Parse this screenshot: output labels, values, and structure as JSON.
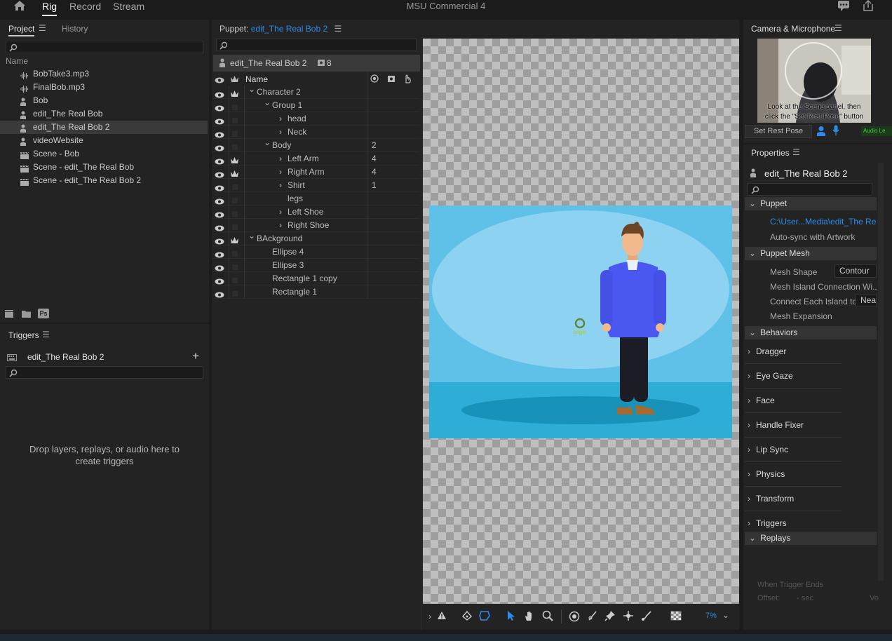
{
  "topbar": {
    "tabs": [
      "Rig",
      "Record",
      "Stream"
    ],
    "title": "MSU Commercial 4"
  },
  "project": {
    "tabs": [
      "Project",
      "History"
    ],
    "column_header": "Name",
    "items": [
      {
        "label": "BobTake3.mp3",
        "icon": "audio-icon"
      },
      {
        "label": "FinalBob.mp3",
        "icon": "audio-icon"
      },
      {
        "label": "Bob",
        "icon": "puppet-icon"
      },
      {
        "label": "edit_The Real Bob",
        "icon": "puppet-icon"
      },
      {
        "label": "edit_The Real Bob 2",
        "icon": "puppet-icon",
        "selected": true
      },
      {
        "label": "videoWebsite",
        "icon": "puppet-icon"
      },
      {
        "label": "Scene - Bob",
        "icon": "scene-icon"
      },
      {
        "label": "Scene - edit_The Real Bob",
        "icon": "scene-icon"
      },
      {
        "label": "Scene - edit_The Real Bob 2",
        "icon": "scene-icon"
      }
    ],
    "footer_ps": "Ps"
  },
  "triggers": {
    "title": "Triggers",
    "puppet": "edit_The Real Bob 2",
    "drop_text_1": "Drop layers, replays, or audio here to",
    "drop_text_2": "create triggers"
  },
  "puppet_panel": {
    "title_prefix": "Puppet:",
    "title_link": "edit_The Real Bob 2",
    "puppet_name": "edit_The Real Bob 2",
    "count": "8",
    "col_name": "Name",
    "layers": [
      {
        "label": "Character 2",
        "indent": 0,
        "chevron": "down",
        "crown": true,
        "count": ""
      },
      {
        "label": "Group 1",
        "indent": 1,
        "chevron": "down",
        "crown": false,
        "count": ""
      },
      {
        "label": "head",
        "indent": 2,
        "chevron": "right",
        "crown": false,
        "count": ""
      },
      {
        "label": "Neck",
        "indent": 2,
        "chevron": "right",
        "crown": false,
        "count": ""
      },
      {
        "label": "Body",
        "indent": 1,
        "chevron": "down",
        "crown": false,
        "count": "2"
      },
      {
        "label": "Left Arm",
        "indent": 2,
        "chevron": "right",
        "crown": true,
        "count": "4"
      },
      {
        "label": "Right Arm",
        "indent": 2,
        "chevron": "right",
        "crown": true,
        "count": "4"
      },
      {
        "label": "Shirt",
        "indent": 2,
        "chevron": "right",
        "crown": false,
        "count": "1"
      },
      {
        "label": "legs",
        "indent": 2,
        "chevron": "",
        "crown": false,
        "count": ""
      },
      {
        "label": "Left Shoe",
        "indent": 2,
        "chevron": "right",
        "crown": false,
        "count": ""
      },
      {
        "label": "Right Shoe",
        "indent": 2,
        "chevron": "right",
        "crown": false,
        "count": ""
      },
      {
        "label": "BAckground",
        "indent": 0,
        "chevron": "down",
        "crown": true,
        "count": ""
      },
      {
        "label": "Ellipse 4",
        "indent": 1,
        "chevron": "",
        "crown": false,
        "count": ""
      },
      {
        "label": "Ellipse 3",
        "indent": 1,
        "chevron": "",
        "crown": false,
        "count": ""
      },
      {
        "label": "Rectangle 1 copy",
        "indent": 1,
        "chevron": "",
        "crown": false,
        "count": ""
      },
      {
        "label": "Rectangle 1",
        "indent": 1,
        "chevron": "",
        "crown": false,
        "count": ""
      }
    ]
  },
  "canvas": {
    "origin_label": "origin",
    "zoom": "7%"
  },
  "camera": {
    "title": "Camera & Microphone",
    "hint_1": "Look at the Scene panel, then",
    "hint_2": "click the \"Set Rest Pose\" button below",
    "set_rest_pose": "Set Rest Pose",
    "audio_level": "Audio Le"
  },
  "properties": {
    "title": "Properties",
    "puppet_name": "edit_The Real Bob 2",
    "puppet_section": "Puppet",
    "path": "C:\\User...Media\\edit_The Real B",
    "autosync": "Auto-sync with Artwork",
    "mesh_section": "Puppet Mesh",
    "mesh_shape_label": "Mesh Shape",
    "mesh_shape_value": "Contour",
    "mesh_island": "Mesh Island Connection Wi...",
    "connect_each": "Connect Each Island to",
    "connect_value": "Near",
    "mesh_expansion": "Mesh Expansion",
    "behaviors_section": "Behaviors",
    "behaviors": [
      "Dragger",
      "Eye Gaze",
      "Face",
      "Handle Fixer",
      "Lip Sync",
      "Physics",
      "Transform",
      "Triggers"
    ],
    "replays_section": "Replays",
    "when_trigger_ends": "When Trigger Ends",
    "offset_label": "Offset:",
    "offset_value": "- sec",
    "vo": "Vo"
  },
  "colors": {
    "accent": "#2d8ceb",
    "sky": "#5fc1e8",
    "ground": "#2eaed6",
    "shirt": "#4a57f0"
  }
}
